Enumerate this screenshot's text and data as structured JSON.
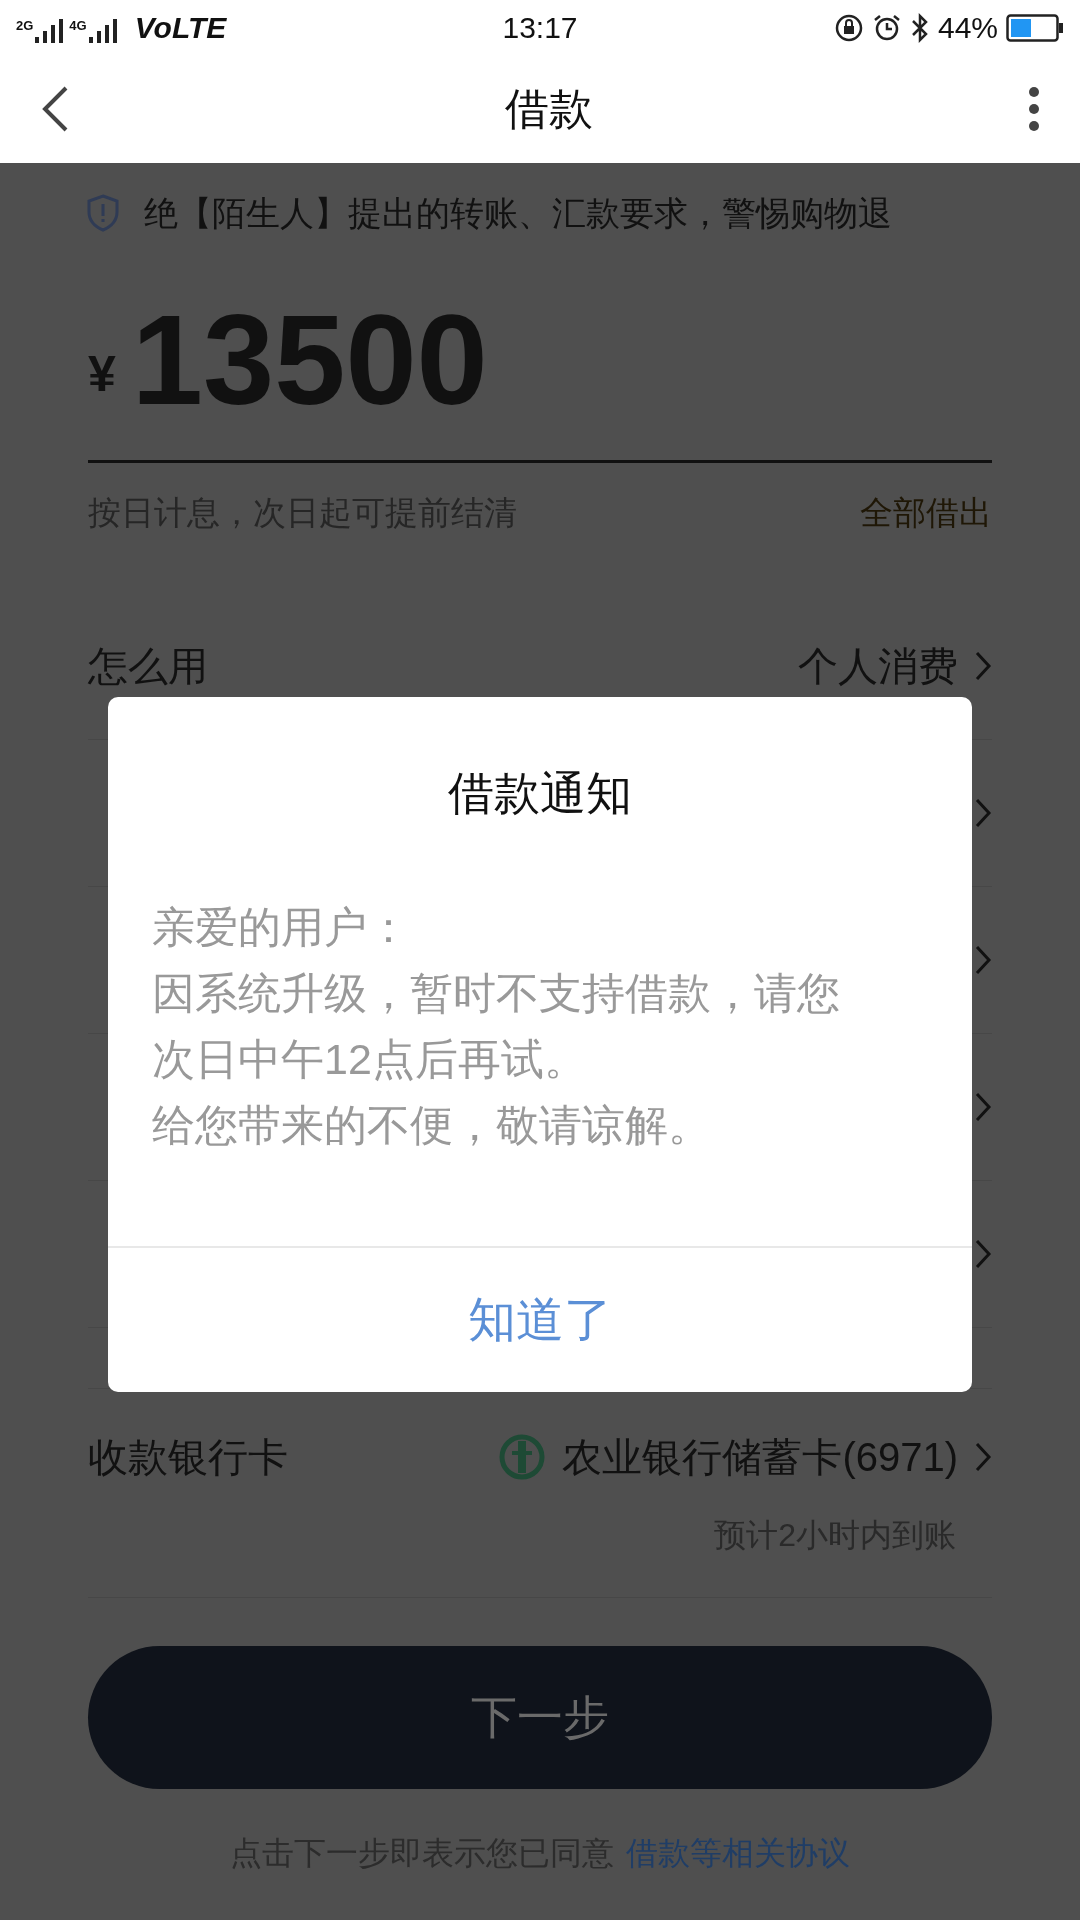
{
  "status_bar": {
    "carrier": "VoLTE",
    "time": "13:17",
    "battery": "44%",
    "signal_labels": [
      "2G",
      "4G"
    ]
  },
  "nav": {
    "title": "借款"
  },
  "banner": {
    "text": "绝【陌生人】提出的转账、汇款要求，警惕购物退"
  },
  "amount": {
    "currency": "¥",
    "value": "13500",
    "hint": "按日计息，次日起可提前结清",
    "action": "全部借出"
  },
  "rows": [
    {
      "kind": "text",
      "label": "怎么用",
      "value": "个人消费"
    },
    {
      "kind": "covered"
    },
    {
      "kind": "covered"
    },
    {
      "kind": "covered"
    },
    {
      "kind": "covered"
    }
  ],
  "bank": {
    "label": "收款银行卡",
    "card": "农业银行储蓄卡(6971)",
    "note": "预计2小时内到账"
  },
  "next_button": "下一步",
  "agreement": {
    "text": "点击下一步即表示您已同意",
    "link": "借款等相关协议"
  },
  "dialog": {
    "title": "借款通知",
    "lines": [
      "亲爱的用户：",
      "因系统升级，暂时不支持借款，请您次日中午12点后再试。",
      "给您带来的不便，敬请谅解。"
    ],
    "button": "知道了"
  }
}
